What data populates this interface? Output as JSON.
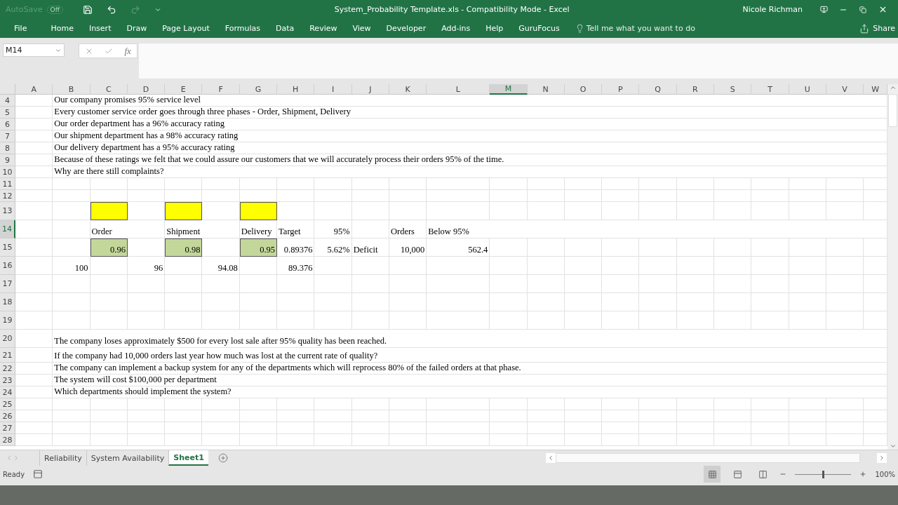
{
  "window": {
    "title": "System_Probability Template.xls  -  Compatibility Mode  -  Excel",
    "user": "Nicole Richman",
    "autosave": {
      "label": "AutoSave",
      "state": "Off"
    }
  },
  "ribbon": {
    "tabs": [
      "File",
      "Home",
      "Insert",
      "Draw",
      "Page Layout",
      "Formulas",
      "Data",
      "Review",
      "View",
      "Developer",
      "Add-ins",
      "Help",
      "GuruFocus"
    ],
    "tell_me": "Tell me what you want to do",
    "share": "Share"
  },
  "formula_bar": {
    "name_box": "M14",
    "fx": "fx"
  },
  "sheet": {
    "columns": [
      {
        "label": "A",
        "selected": false
      },
      {
        "label": "B",
        "selected": false
      },
      {
        "label": "C",
        "selected": false
      },
      {
        "label": "D",
        "selected": false
      },
      {
        "label": "E",
        "selected": false
      },
      {
        "label": "F",
        "selected": false
      },
      {
        "label": "G",
        "selected": false
      },
      {
        "label": "H",
        "selected": false
      },
      {
        "label": "I",
        "selected": false
      },
      {
        "label": "J",
        "selected": false
      },
      {
        "label": "K",
        "selected": false
      },
      {
        "label": "L",
        "selected": false
      },
      {
        "label": "M",
        "selected": true
      },
      {
        "label": "N",
        "selected": false
      },
      {
        "label": "O",
        "selected": false
      },
      {
        "label": "P",
        "selected": false
      },
      {
        "label": "Q",
        "selected": false
      },
      {
        "label": "R",
        "selected": false
      },
      {
        "label": "S",
        "selected": false
      },
      {
        "label": "T",
        "selected": false
      },
      {
        "label": "U",
        "selected": false
      },
      {
        "label": "V",
        "selected": false
      },
      {
        "label": "W",
        "selected": false
      }
    ],
    "rows": [
      {
        "number": "4",
        "selected": false,
        "cells": [
          {},
          {
            "kind": "text",
            "value": "Our company promises 95% service level"
          }
        ]
      },
      {
        "number": "5",
        "selected": false,
        "cells": [
          {},
          {
            "kind": "text",
            "value": "Every customer service order goes through three phases - Order, Shipment, Delivery"
          }
        ]
      },
      {
        "number": "6",
        "selected": false,
        "cells": [
          {},
          {
            "kind": "text",
            "value": "Our order department has a 96% accuracy rating"
          }
        ]
      },
      {
        "number": "7",
        "selected": false,
        "cells": [
          {},
          {
            "kind": "text",
            "value": "Our shipment department has a 98% accuracy rating"
          }
        ]
      },
      {
        "number": "8",
        "selected": false,
        "cells": [
          {},
          {
            "kind": "text",
            "value": "Our delivery department has a 95% accuracy rating"
          }
        ]
      },
      {
        "number": "9",
        "selected": false,
        "cells": [
          {},
          {
            "kind": "text",
            "value": "Because of these ratings we felt that we could assure our customers that we will accurately process their orders 95% of the time."
          }
        ]
      },
      {
        "number": "10",
        "selected": false,
        "cells": [
          {},
          {
            "kind": "text",
            "value": "Why are there still complaints?"
          }
        ]
      },
      {
        "number": "11",
        "selected": false
      },
      {
        "number": "12",
        "selected": false
      },
      {
        "number": "13",
        "selected": false,
        "cells": [
          {},
          {},
          {
            "kind": "fill",
            "color": "#ffff00"
          },
          {},
          {
            "kind": "fill",
            "color": "#ffff00"
          },
          {},
          {
            "kind": "fill",
            "color": "#ffff00"
          }
        ]
      },
      {
        "number": "14",
        "selected": true,
        "cells": [
          {},
          {},
          {
            "kind": "text",
            "value": "Order"
          },
          {},
          {
            "kind": "text",
            "value": "Shipment"
          },
          {},
          {
            "kind": "text",
            "value": "Delivery"
          },
          {
            "kind": "text",
            "value": "Target"
          },
          {
            "kind": "number",
            "value": "95%"
          },
          {},
          {
            "kind": "text",
            "value": "Orders"
          },
          {
            "kind": "text",
            "value": "Below 95%"
          }
        ]
      },
      {
        "number": "15",
        "selected": false,
        "cells": [
          {},
          {},
          {
            "kind": "number",
            "value": "0.96",
            "color": "#c4d79b"
          },
          {},
          {
            "kind": "number",
            "value": "0.98",
            "color": "#c4d79b"
          },
          {},
          {
            "kind": "number",
            "value": "0.95",
            "color": "#c4d79b"
          },
          {
            "kind": "number",
            "value": "0.89376"
          },
          {
            "kind": "number",
            "value": "5.62%"
          },
          {
            "kind": "text",
            "value": "Deficit"
          },
          {
            "kind": "number",
            "value": "10,000"
          },
          {
            "kind": "number",
            "value": "562.4"
          }
        ]
      },
      {
        "number": "16",
        "selected": false,
        "cells": [
          {},
          {
            "kind": "number",
            "value": "100"
          },
          {},
          {
            "kind": "number",
            "value": "96"
          },
          {},
          {
            "kind": "number",
            "value": "94.08"
          },
          {},
          {
            "kind": "number",
            "value": "89.376"
          }
        ]
      },
      {
        "number": "17",
        "selected": false
      },
      {
        "number": "18",
        "selected": false
      },
      {
        "number": "19",
        "selected": false
      },
      {
        "number": "20",
        "selected": false,
        "cells": [
          {},
          {
            "kind": "text",
            "value": "The company loses approximately $500 for every lost sale after 95% quality has been reached."
          }
        ]
      },
      {
        "number": "21",
        "selected": false,
        "cells": [
          {},
          {
            "kind": "text",
            "value": "If the company had 10,000 orders last year how much was lost at the current rate of quality?"
          }
        ]
      },
      {
        "number": "22",
        "selected": false,
        "cells": [
          {},
          {
            "kind": "text",
            "value": "The company can implement a backup system for any of the departments which will reprocess 80% of the failed orders at that phase."
          }
        ]
      },
      {
        "number": "23",
        "selected": false,
        "cells": [
          {},
          {
            "kind": "text",
            "value": "The system will cost $100,000 per department"
          }
        ]
      },
      {
        "number": "24",
        "selected": false,
        "cells": [
          {},
          {
            "kind": "text",
            "value": "Which departments should implement the system?"
          }
        ]
      },
      {
        "number": "25",
        "selected": false
      },
      {
        "number": "26",
        "selected": false
      },
      {
        "number": "27",
        "selected": false
      },
      {
        "number": "28",
        "selected": false
      }
    ]
  },
  "sheet_tabs": [
    {
      "label": "Reliability",
      "selected": false
    },
    {
      "label": "System Availability",
      "selected": false
    },
    {
      "label": "Sheet1",
      "selected": true
    }
  ],
  "status_bar": {
    "status": "Ready",
    "zoom": {
      "reading": "100%",
      "level": 0.5
    }
  }
}
